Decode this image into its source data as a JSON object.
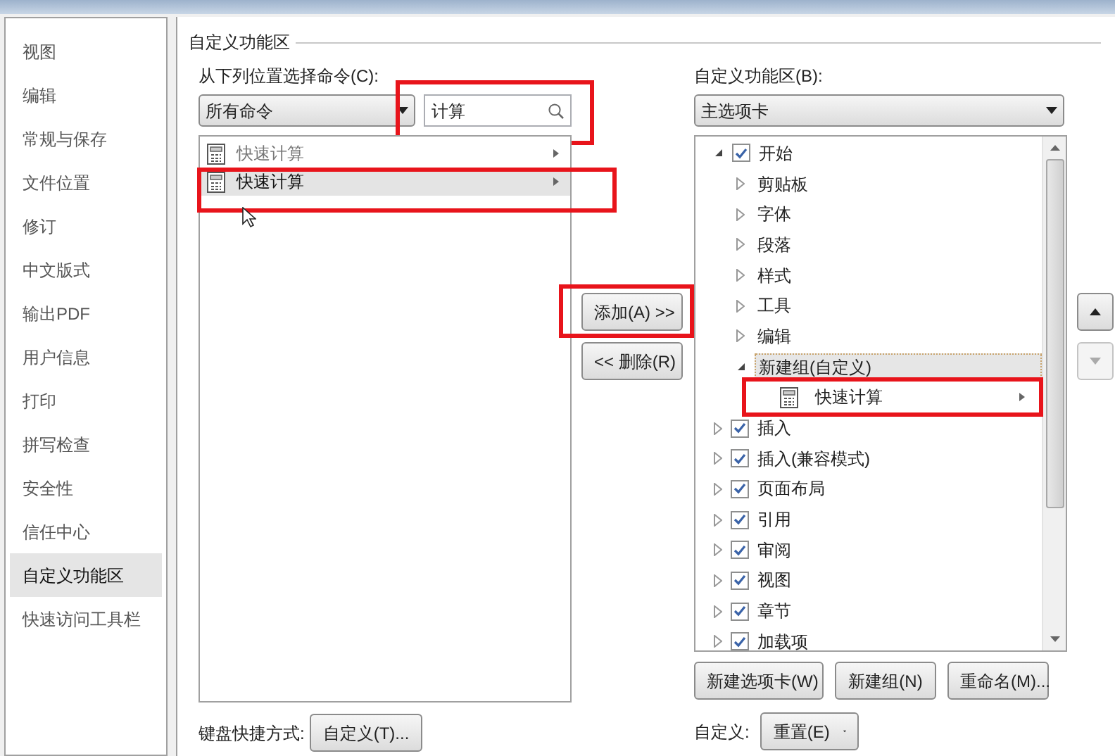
{
  "sidebar": {
    "items": [
      {
        "label": "视图",
        "selected": false
      },
      {
        "label": "编辑",
        "selected": false
      },
      {
        "label": "常规与保存",
        "selected": false
      },
      {
        "label": "文件位置",
        "selected": false
      },
      {
        "label": "修订",
        "selected": false
      },
      {
        "label": "中文版式",
        "selected": false
      },
      {
        "label": "输出PDF",
        "selected": false
      },
      {
        "label": "用户信息",
        "selected": false
      },
      {
        "label": "打印",
        "selected": false
      },
      {
        "label": "拼写检查",
        "selected": false
      },
      {
        "label": "安全性",
        "selected": false
      },
      {
        "label": "信任中心",
        "selected": false
      },
      {
        "label": "自定义功能区",
        "selected": true
      },
      {
        "label": "快速访问工具栏",
        "selected": false
      }
    ]
  },
  "section_title": "自定义功能区",
  "commands": {
    "label": "从下列位置选择命令(C):",
    "source": "所有命令",
    "search": {
      "value": "计算",
      "highlighted": true
    },
    "items": [
      {
        "label": "快速计算",
        "selected": false,
        "highlighted": false
      },
      {
        "label": "快速计算",
        "selected": true,
        "highlighted": true
      }
    ],
    "shortcut_label": "键盘快捷方式:",
    "shortcut_button": "自定义(T)..."
  },
  "move_buttons": [
    {
      "label": "添加(A) >>",
      "highlighted": true
    },
    {
      "label": "<< 删除(R)",
      "highlighted": false
    }
  ],
  "ribbon": {
    "label": "自定义功能区(B):",
    "scope": "主选项卡",
    "tree": [
      {
        "label": "开始",
        "checked": true,
        "expanded": true,
        "children": [
          {
            "label": "剪贴板",
            "kind": "group",
            "expanded": false,
            "selected": false
          },
          {
            "label": "字体",
            "kind": "group",
            "expanded": false,
            "selected": false
          },
          {
            "label": "段落",
            "kind": "group",
            "expanded": false,
            "selected": false
          },
          {
            "label": "样式",
            "kind": "group",
            "expanded": false,
            "selected": false
          },
          {
            "label": "工具",
            "kind": "group",
            "expanded": false,
            "selected": false
          },
          {
            "label": "编辑",
            "kind": "group",
            "expanded": false,
            "selected": false
          },
          {
            "label": "新建组(自定义)",
            "kind": "group",
            "expanded": true,
            "selected": true,
            "children": [
              {
                "label": "快速计算",
                "kind": "command",
                "highlighted": true
              }
            ]
          }
        ]
      },
      {
        "label": "插入",
        "checked": true,
        "expanded": false
      },
      {
        "label": "插入(兼容模式)",
        "checked": true,
        "expanded": false
      },
      {
        "label": "页面布局",
        "checked": true,
        "expanded": false
      },
      {
        "label": "引用",
        "checked": true,
        "expanded": false
      },
      {
        "label": "审阅",
        "checked": true,
        "expanded": false
      },
      {
        "label": "视图",
        "checked": true,
        "expanded": false
      },
      {
        "label": "章节",
        "checked": true,
        "expanded": false
      },
      {
        "label": "加载项",
        "checked": true,
        "expanded": false
      }
    ],
    "order_buttons": [
      {
        "kind": "up",
        "disabled": false
      },
      {
        "kind": "down",
        "disabled": true
      }
    ],
    "buttons": [
      "新建选项卡(W)",
      "新建组(N)",
      "重命名(M)..."
    ],
    "reset_label": "自定义:",
    "reset_button": "重置(E)"
  }
}
